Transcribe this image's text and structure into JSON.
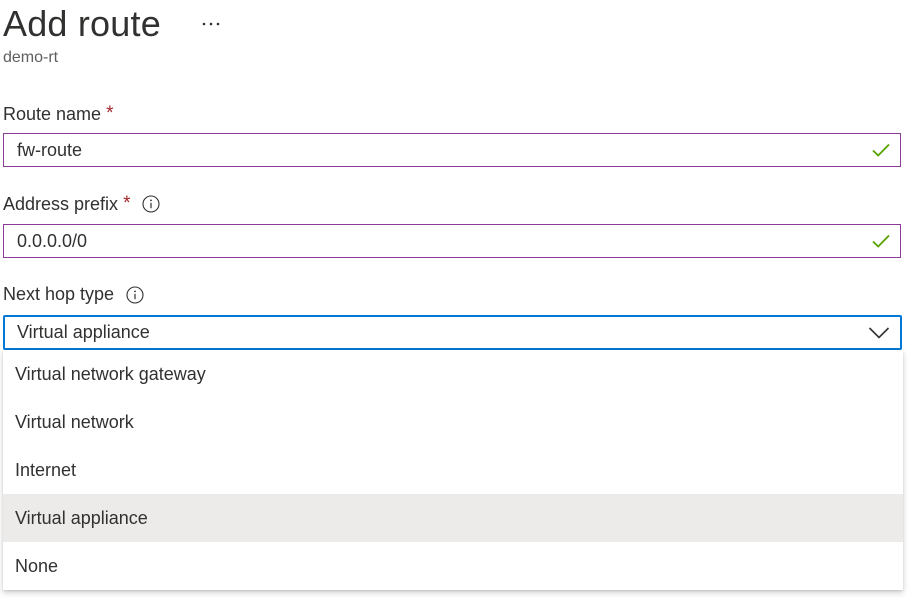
{
  "header": {
    "title": "Add route",
    "more_label": "···",
    "subtitle": "demo-rt"
  },
  "route_name": {
    "label": "Route name",
    "required_mark": "*",
    "value": "fw-route"
  },
  "address_prefix": {
    "label": "Address prefix",
    "required_mark": "*",
    "value": "0.0.0.0/0"
  },
  "next_hop_type": {
    "label": "Next hop type",
    "selected": "Virtual appliance",
    "options": [
      "Virtual network gateway",
      "Virtual network",
      "Internet",
      "Virtual appliance",
      "None"
    ],
    "selected_index": 3
  },
  "colors": {
    "valid_border": "#8a3d94",
    "focus_border": "#0078d4",
    "check": "#57a300",
    "required": "#a4262c",
    "selected_option_bg": "#edebe9"
  }
}
